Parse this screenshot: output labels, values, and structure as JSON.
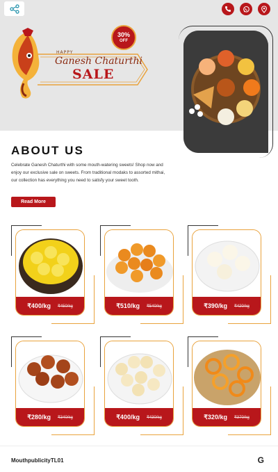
{
  "header": {
    "icons": [
      "share-icon",
      "phone-icon",
      "whatsapp-icon",
      "location-icon"
    ]
  },
  "hero": {
    "badge_line1": "30%",
    "badge_line2": "OFF",
    "happy": "HAPPY",
    "title": "Ganesh Chaturthi",
    "sale": "SALE"
  },
  "about": {
    "title": "ABOUT US",
    "text": "Celebrate Ganesh Chaturthi with some mouth-watering sweets! Shop now and enjoy our exclusive sale on sweets. From traditional modaks to assorted mithai, our collection has everything you need to satisfy your sweet tooth.",
    "button": "Read More"
  },
  "products": [
    {
      "price": "₹400/kg",
      "mrp": "₹450/kg",
      "image": "rasmalai"
    },
    {
      "price": "₹510/kg",
      "mrp": "₹540/kg",
      "image": "motichoor-ladoo"
    },
    {
      "price": "₹390/kg",
      "mrp": "₹420/kg",
      "image": "rasgulla"
    },
    {
      "price": "₹280/kg",
      "mrp": "₹340/kg",
      "image": "gulab-jamun"
    },
    {
      "price": "₹400/kg",
      "mrp": "₹430/kg",
      "image": "peda"
    },
    {
      "price": "₹320/kg",
      "mrp": "₹370/kg",
      "image": "jalebi"
    }
  ],
  "footer": {
    "brand": "MouthpublicityTL01",
    "icon_letter": "G"
  },
  "colors": {
    "accent": "#b8171b",
    "gold": "#e9a23b",
    "hero_bg": "#e6e6e6"
  }
}
